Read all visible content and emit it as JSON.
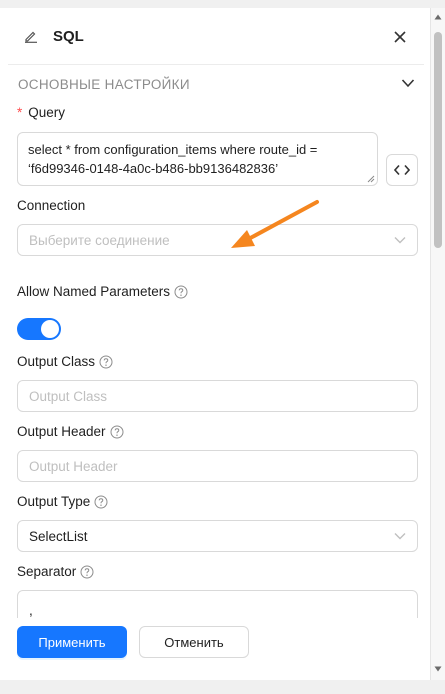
{
  "drawer": {
    "title": "SQL",
    "icons": {
      "edit": "pencil-icon",
      "close": "close-icon"
    }
  },
  "section": {
    "title": "ОСНОВНЫЕ НАСТРОЙКИ",
    "icon": "chevron-down-icon"
  },
  "form": {
    "query": {
      "label": "Query",
      "required_mark": "*",
      "value_line1": "select * from configuration_items where route_id =",
      "value_line2": "‘f6d99346-0148-4a0c-b486-bb9136482836’"
    },
    "connection": {
      "label": "Connection",
      "placeholder": "Выберите соединение"
    },
    "allow_named_parameters": {
      "label": "Allow Named Parameters",
      "enabled": true
    },
    "output_class": {
      "label": "Output Class",
      "placeholder": "Output Class"
    },
    "output_header": {
      "label": "Output Header",
      "placeholder": "Output Header"
    },
    "output_type": {
      "label": "Output Type",
      "value": "SelectList"
    },
    "separator": {
      "label": "Separator",
      "value": ","
    }
  },
  "footer": {
    "apply_label": "Применить",
    "cancel_label": "Отменить"
  },
  "colors": {
    "accent": "#1677ff",
    "annotation_arrow": "#f5861f",
    "required": "#ff4d4f"
  }
}
